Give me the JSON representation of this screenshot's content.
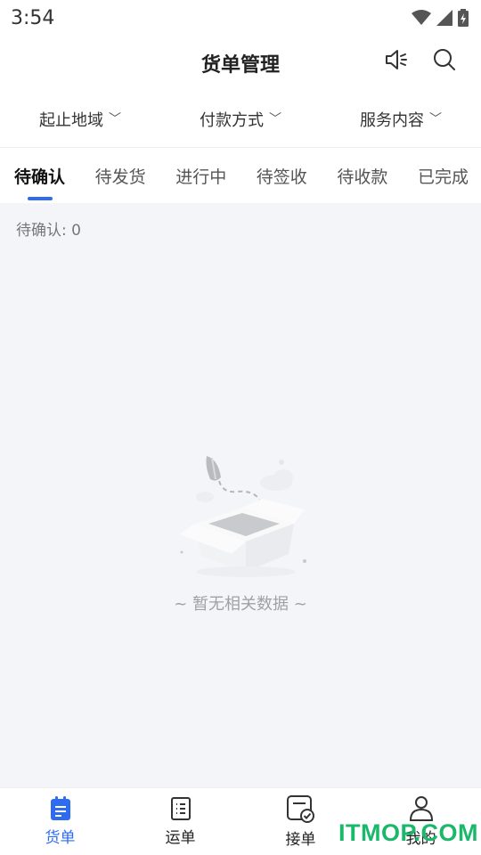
{
  "status_bar": {
    "time": "3:54"
  },
  "header": {
    "title": "货单管理",
    "icons": [
      "speaker-icon",
      "search-icon"
    ]
  },
  "filters": [
    {
      "label": "起止地域",
      "chevron": "﹀"
    },
    {
      "label": "付款方式",
      "chevron": "﹀"
    },
    {
      "label": "服务内容",
      "chevron": "﹀"
    }
  ],
  "tabs": [
    {
      "label": "待确认",
      "active": true
    },
    {
      "label": "待发货"
    },
    {
      "label": "进行中"
    },
    {
      "label": "待签收"
    },
    {
      "label": "待收款"
    },
    {
      "label": "已完成"
    }
  ],
  "content": {
    "count_text": "待确认: 0",
    "empty_text": "~ 暂无相关数据 ~"
  },
  "bottom_nav": [
    {
      "label": "货单",
      "icon": "document-icon",
      "active": true
    },
    {
      "label": "运单",
      "icon": "list-icon"
    },
    {
      "label": "接单",
      "icon": "accept-order-icon"
    },
    {
      "label": "我的",
      "icon": "user-icon"
    }
  ],
  "watermark": "ITMOP.COM",
  "colors": {
    "accent": "#2d6cf0",
    "background": "#f4f5f9",
    "watermark": "#19b86b"
  }
}
